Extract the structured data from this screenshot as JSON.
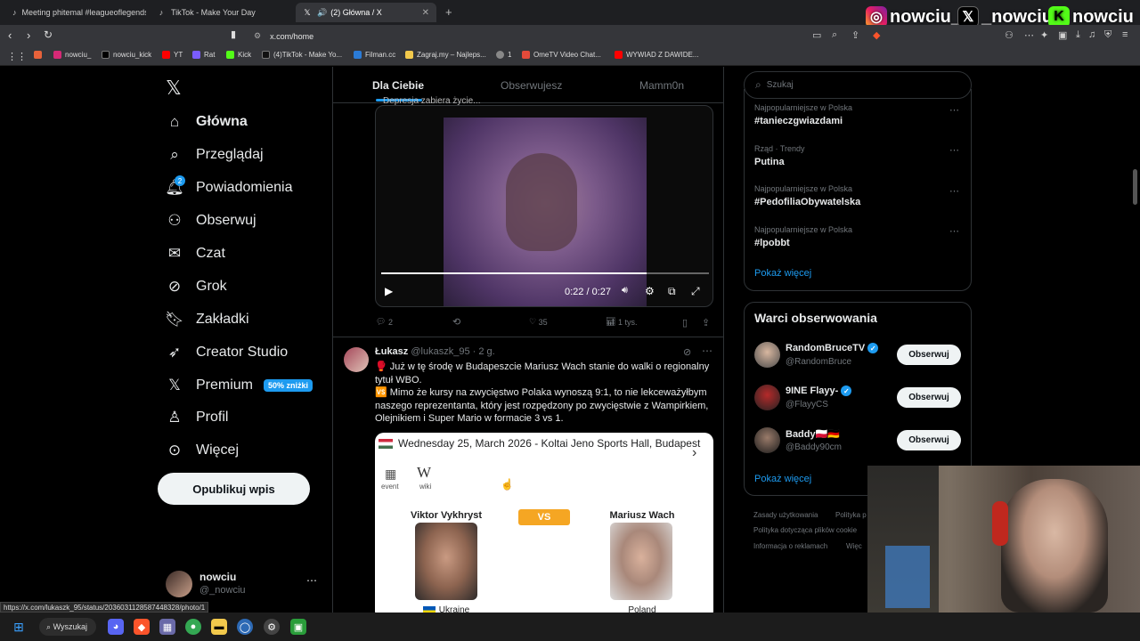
{
  "browser": {
    "tabs": [
      {
        "label": "Meeting phitemal #leagueoflegends",
        "icon": "tiktok-icon"
      },
      {
        "label": "TikTok - Make Your Day",
        "icon": "tiktok-icon"
      },
      {
        "label": "(2) Główna / X",
        "icon": "x-icon"
      }
    ],
    "url": "x.com/home",
    "bookmarks": [
      "nowciu_",
      "nowciu_kick",
      "YT",
      "Rat",
      "Kick",
      "(4)TikTok - Make Yo...",
      "Filman.cc",
      "Zagraj.my – Najleps...",
      "1",
      "OmeTV Video Chat...",
      "WYWIAD Z DAWIDE..."
    ],
    "status_url": "https://x.com/lukaszk_95/status/2036031128587448328/photo/1"
  },
  "overlay": {
    "instagram": "nowciu_",
    "x": "_nowciu",
    "kick": "nowciu"
  },
  "sidebar": {
    "items": [
      {
        "label": "Główna",
        "icon": "home-icon"
      },
      {
        "label": "Przeglądaj",
        "icon": "search-icon"
      },
      {
        "label": "Powiadomienia",
        "icon": "bell-icon",
        "badge": "2"
      },
      {
        "label": "Obserwuj",
        "icon": "follow-icon"
      },
      {
        "label": "Czat",
        "icon": "mail-icon"
      },
      {
        "label": "Grok",
        "icon": "grok-icon"
      },
      {
        "label": "Zakładki",
        "icon": "bookmark-icon"
      },
      {
        "label": "Creator Studio",
        "icon": "rocket-icon"
      },
      {
        "label": "Premium",
        "icon": "x-icon",
        "badge": "50% zniżki"
      },
      {
        "label": "Profil",
        "icon": "profile-icon"
      },
      {
        "label": "Więcej",
        "icon": "more-icon"
      }
    ],
    "post_button": "Opublikuj wpis",
    "account": {
      "name": "nowciu",
      "handle": "@_nowciu"
    }
  },
  "feed": {
    "tabs": [
      "Dla Ciebie",
      "Obserwujesz",
      "Mamm0n"
    ],
    "top_cut_text": "Depresja zabiera życie...",
    "video": {
      "time": "0:22 / 0:27",
      "progress": 0.81
    },
    "post1_stats": {
      "replies": "2",
      "reposts": "",
      "likes": "35",
      "views": "1 tys."
    },
    "post2": {
      "name": "Łukasz",
      "handle": "@lukaszk_95",
      "time": "· 2 g.",
      "line1": "🥊 Już w tę środę w Budapeszcie Mariusz Wach stanie do walki o regionalny tytuł WBO.",
      "line2": "🆚 Mimo że kursy na zwycięstwo Polaka wynoszą 9:1, to nie lekceważyłbym naszego reprezentanta, który jest rozpędzony po zwycięstwie z Wampirkiem, Olejnikiem i Super Mario w formacie 3 vs 1.",
      "card": {
        "header": "Wednesday 25, March 2026  -  Koltai Jeno Sports Hall, Budapest",
        "event_label": "event",
        "wiki_label": "wiki",
        "fighter1": "Viktor Vykhryst",
        "fighter1_country": "Ukraine",
        "vs": "VS",
        "fighter2": "Mariusz Wach",
        "fighter2_country": "Poland"
      }
    }
  },
  "right": {
    "search_placeholder": "Szukaj",
    "trends": [
      {
        "context": "Najpopularniejsze w Polska",
        "name": "#tanieczgwiazdami"
      },
      {
        "context": "Rząd · Trendy",
        "name": "Putina"
      },
      {
        "context": "Najpopularniejsze w Polska",
        "name": "#PedofiliaObywatelska"
      },
      {
        "context": "Najpopularniejsze w Polska",
        "name": "#lpobbt"
      }
    ],
    "show_more": "Pokaż więcej",
    "who_to_follow_title": "Warci obserwowania",
    "follow": [
      {
        "name": "RandomBruceTV",
        "handle": "@RandomBruce",
        "verified": true
      },
      {
        "name": "9INE Flayy-",
        "handle": "@FlayyCS",
        "verified": true
      },
      {
        "name": "Baddy🇵🇱🇩🇪",
        "handle": "@Baddy90cm",
        "verified": false
      }
    ],
    "follow_button": "Obserwuj",
    "show_more2": "Pokaż więcej",
    "footer": [
      "Zasady użytkowania",
      "Polityka p",
      "Polityka dotycząca plików cookie",
      "Informacja o reklamach",
      "Więc"
    ]
  },
  "taskbar": {
    "search": "Wyszukaj"
  },
  "colors": {
    "accent": "#1d9bf0",
    "bg": "#000000",
    "badge": "#f5a623"
  }
}
